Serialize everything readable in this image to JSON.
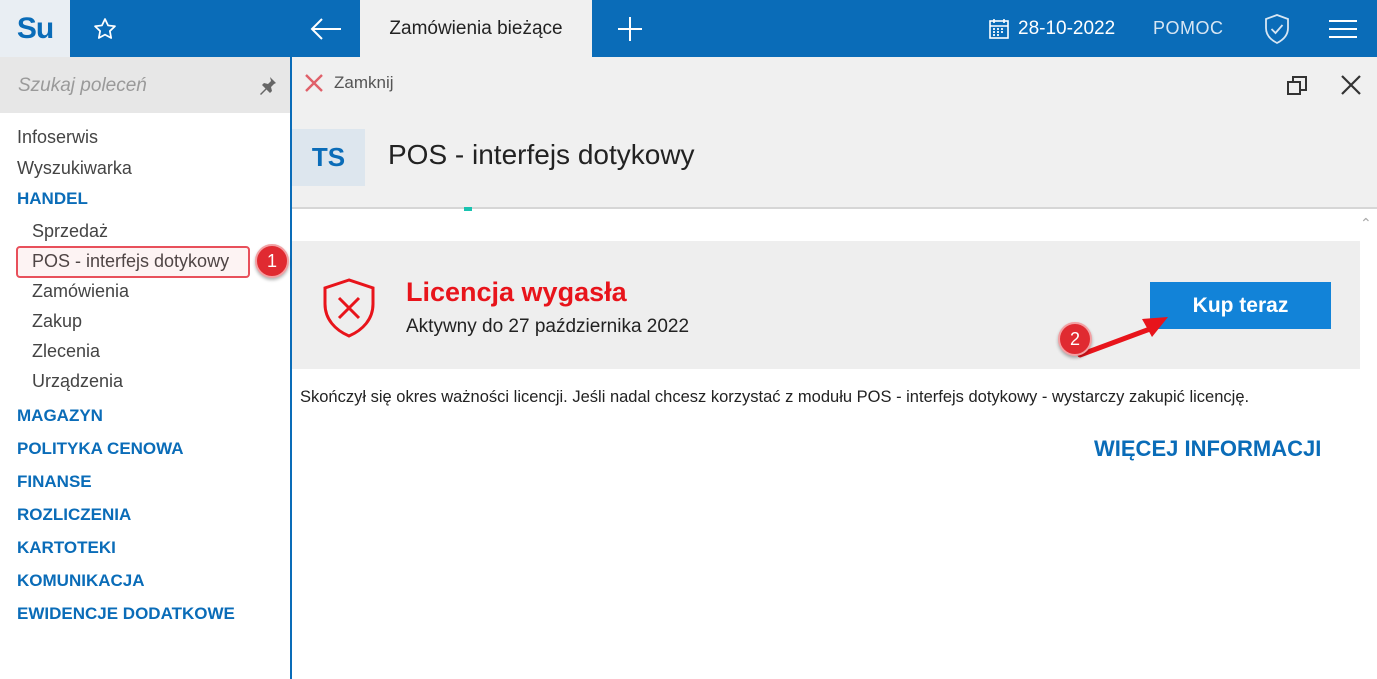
{
  "app": {
    "logo": "Su",
    "active_tab": "Zamówienia bieżące",
    "date": "28-10-2022",
    "help": "POMOC"
  },
  "sidebar": {
    "search_placeholder": "Szukaj poleceń",
    "items": [
      {
        "label": "Infoserwis"
      },
      {
        "label": "Wyszukiwarka"
      },
      {
        "label": "HANDEL"
      },
      {
        "label": "Sprzedaż"
      },
      {
        "label": "POS - interfejs dotykowy"
      },
      {
        "label": "Zamówienia"
      },
      {
        "label": "Zakup"
      },
      {
        "label": "Zlecenia"
      },
      {
        "label": "Urządzenia"
      },
      {
        "label": "MAGAZYN"
      },
      {
        "label": "POLITYKA CENOWA"
      },
      {
        "label": "FINANSE"
      },
      {
        "label": "ROZLICZENIA"
      },
      {
        "label": "KARTOTEKI"
      },
      {
        "label": "KOMUNIKACJA"
      },
      {
        "label": "EWIDENCJE DODATKOWE"
      }
    ]
  },
  "main": {
    "close_label": "Zamknij",
    "module_code": "TS",
    "title": "POS - interfejs dotykowy",
    "license": {
      "title": "Licencja wygasła",
      "subtitle": "Aktywny do 27 października 2022",
      "buy_label": "Kup teraz"
    },
    "description": "Skończył się okres ważności licencji. Jeśli nadal chcesz korzystać z modułu POS - interfejs dotykowy - wystarczy zakupić licencję.",
    "more_label": "WIĘCEJ INFORMACJI"
  },
  "annotations": {
    "badge1": "1",
    "badge2": "2"
  },
  "colors": {
    "brand": "#0a6cb8",
    "error": "#e8141b",
    "button": "#1283d8",
    "annotation": "#e02a31"
  }
}
